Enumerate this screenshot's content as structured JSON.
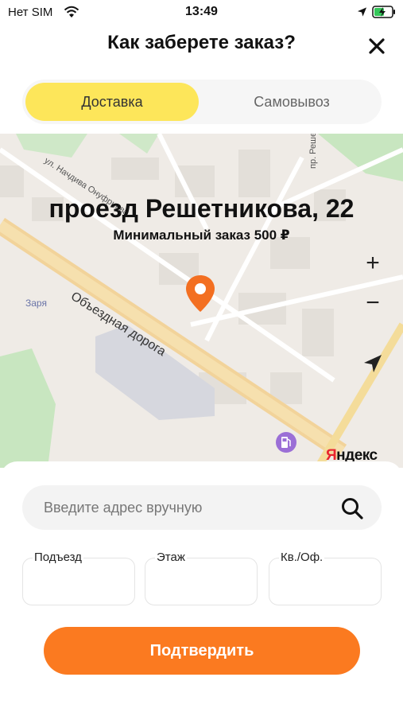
{
  "status_bar": {
    "carrier": "Нет SIM",
    "time": "13:49",
    "icons": [
      "wifi-icon",
      "location-arrow-icon",
      "battery-charging-icon"
    ]
  },
  "header": {
    "title": "Как заберете заказ?",
    "close_icon": "close-icon"
  },
  "tabs": [
    {
      "label": "Доставка",
      "active": true
    },
    {
      "label": "Самовывоз",
      "active": false
    }
  ],
  "map": {
    "address": "проезд Решетникова, 22",
    "min_order": "Минимальный заказ 500 ₽",
    "streets": [
      "Объездная дорога",
      "ул. Начдива Онуфриева",
      "пр. Решетникова"
    ],
    "district": "Заря",
    "zoom_in": "+",
    "zoom_out": "−",
    "provider_logo": "Яндекс",
    "accent_color": "#f36f21"
  },
  "form": {
    "search_placeholder": "Введите адрес вручную",
    "fields": [
      {
        "label": "Подъезд",
        "value": ""
      },
      {
        "label": "Этаж",
        "value": ""
      },
      {
        "label": "Кв./Оф.",
        "value": ""
      }
    ],
    "confirm_label": "Подтвердить"
  },
  "colors": {
    "tab_active": "#fde65a",
    "confirm_button": "#fb7a20"
  }
}
